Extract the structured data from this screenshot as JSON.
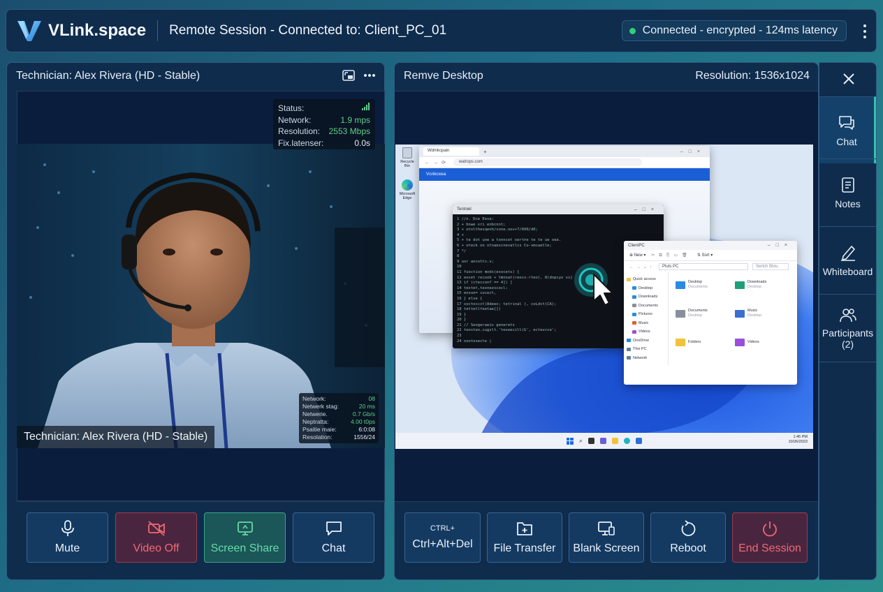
{
  "app": {
    "name": "VLink.space",
    "session_title": "Remote Session - Connected to: Client_PC_01",
    "connection_status": "Connected - encrypted - 124ms latency",
    "accent_color": "#2fc3b1",
    "status_color": "#2fd07a"
  },
  "left_panel": {
    "title": "Technician: Alex Rivera (HD - Stable)",
    "caption": "Technician: Alex Rivera (HD - Stable)",
    "icons": [
      "picture-in-picture-icon",
      "more-horizontal-icon"
    ],
    "overlay_stats": [
      {
        "label": "Status:",
        "value": ""
      },
      {
        "label": "Network:",
        "value": "1.9 mps"
      },
      {
        "label": "Resolution:",
        "value": "2553 Mbps"
      },
      {
        "label": "Fix.latenser:",
        "value": "0.0s"
      }
    ],
    "corner_stats": [
      {
        "label": "Network:",
        "value": "08"
      },
      {
        "label": "Netwerk stag:",
        "value": "20 ms"
      },
      {
        "label": "Netwerie.",
        "value": "0.7 Gb/s"
      },
      {
        "label": "Neptratta:",
        "value": "4.00 t0ps"
      },
      {
        "label": "Psaitie maie:",
        "value": "6:0:08"
      },
      {
        "label": "Resolation:",
        "value": "1556/24"
      }
    ],
    "controls": [
      {
        "label": "Mute",
        "icon": "microphone-icon"
      },
      {
        "label": "Video Off",
        "icon": "video-off-icon"
      },
      {
        "label": "Screen Share",
        "icon": "screen-share-icon"
      },
      {
        "label": "Chat",
        "icon": "chat-icon"
      }
    ]
  },
  "right_panel": {
    "title": "Remve Desktop",
    "resolution": "Resolution: 1536x1024",
    "controls": [
      {
        "label": "Ctrl+Alt+Del",
        "icon_text": "CTRL+"
      },
      {
        "label": "File Transfer",
        "icon": "file-transfer-icon"
      },
      {
        "label": "Blank Screen",
        "icon": "blank-screen-icon"
      },
      {
        "label": "Reboot",
        "icon": "reboot-icon"
      },
      {
        "label": "End Session",
        "icon": "power-icon"
      }
    ],
    "desktop": {
      "browser_tab": "Wdmkcpain",
      "browser_url": "watrops.com",
      "browser_page_title": "Vcnkcxea",
      "terminal_title": "Tentniel",
      "terminal_lines": [
        "1 //n. Dce Eese:",
        "2 + bnwe vri enbcnnt;",
        "3 + otnlthesqenh/sone.oov+7/600/d0;",
        "4 +",
        "5 + te dot uoe a tonncet oertne te te ue oea.",
        "6 + oteck on otnaescnevatlcs Co-vmcaetle;",
        "7 */",
        "8",
        "9 uor ancotts.v;",
        "10",
        "11 fuoction mods(esocets) {",
        "12     eocet recoob + tmnoat(reocs-rteo(, 8(dnpcyo ss]",
        "13     if (ctecconf == 4]) ]",
        "14         textet,texnezscocl;",
        "15         ensoo= cocect,",
        "16     } else {",
        "17         soctoccct(8deeo; tetrinal (, coLdct(CA);",
        "18         tettetlfeetae[])",
        "19     }",
        "20 }",
        "21 // Seogeraeis generets",
        "22 teosteo.cugslt.'teseecilt(G', ectevcce';",
        "23",
        "24 oootosecte |"
      ],
      "explorer_title": "ClientPC",
      "explorer_path": "Pluts PC",
      "explorer_search": "Sertch Btov..",
      "explorer_new": "New",
      "explorer_sort": "Sort",
      "explorer_nav": [
        "Quick access",
        "Desktop",
        "Downloads",
        "Documents",
        "Pictures",
        "Music",
        "Videos",
        "OneDrive",
        "This PC",
        "Network"
      ],
      "explorer_folders": [
        {
          "name": "Desktop",
          "sub": "Documents"
        },
        {
          "name": "Downloads",
          "sub": "Desktop"
        },
        {
          "name": "Documents",
          "sub": "Desktop"
        },
        {
          "name": "Music",
          "sub": "Desktop"
        },
        {
          "name": "Folders",
          "sub": ""
        },
        {
          "name": "Videos",
          "sub": ""
        }
      ],
      "desktop_icons": [
        "Recycle Bin",
        "Microsoft Edge"
      ],
      "taskbar_time": "1:45 PM",
      "taskbar_date": "10/26/2023"
    }
  },
  "sidebar": {
    "items": [
      {
        "label": "Chat",
        "icon": "chat-icon"
      },
      {
        "label": "Notes",
        "icon": "notes-icon"
      },
      {
        "label": "Whiteboard",
        "icon": "pen-icon"
      },
      {
        "label": "Participants",
        "count": "(2)",
        "icon": "participants-icon"
      }
    ]
  }
}
